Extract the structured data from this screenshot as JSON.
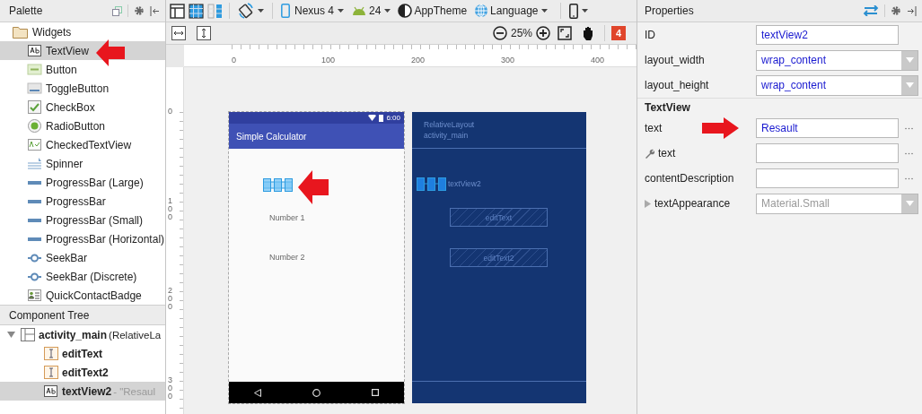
{
  "palette": {
    "title": "Palette",
    "category": {
      "label": "Widgets",
      "items": [
        {
          "label": "TextView",
          "kind": "textview",
          "selected": true
        },
        {
          "label": "Button",
          "kind": "button",
          "selected": false
        },
        {
          "label": "ToggleButton",
          "kind": "toggle",
          "selected": false
        },
        {
          "label": "CheckBox",
          "kind": "checkbox",
          "selected": false
        },
        {
          "label": "RadioButton",
          "kind": "radio",
          "selected": false
        },
        {
          "label": "CheckedTextView",
          "kind": "checkedtext",
          "selected": false
        },
        {
          "label": "Spinner",
          "kind": "spinner",
          "selected": false
        },
        {
          "label": "ProgressBar (Large)",
          "kind": "progress",
          "selected": false
        },
        {
          "label": "ProgressBar",
          "kind": "progress",
          "selected": false
        },
        {
          "label": "ProgressBar (Small)",
          "kind": "progress",
          "selected": false
        },
        {
          "label": "ProgressBar (Horizontal)",
          "kind": "progress",
          "selected": false
        },
        {
          "label": "SeekBar",
          "kind": "seekbar",
          "selected": false
        },
        {
          "label": "SeekBar (Discrete)",
          "kind": "seekbar",
          "selected": false
        },
        {
          "label": "QuickContactBadge",
          "kind": "contact",
          "selected": false
        }
      ]
    }
  },
  "component_tree": {
    "title": "Component Tree",
    "root": {
      "label": "activity_main",
      "detail": "(RelativeLa",
      "kind": "layout",
      "expanded": true,
      "selected": false,
      "children": [
        {
          "label": "editText",
          "kind": "edittext",
          "selected": false
        },
        {
          "label": "editText2",
          "kind": "edittext",
          "selected": false
        },
        {
          "label": "textView2",
          "detail": "- \"Resaul",
          "kind": "textview",
          "selected": true
        }
      ]
    }
  },
  "toolbar": {
    "device": "Nexus 4",
    "api": "24",
    "theme": "AppTheme",
    "language": "Language",
    "zoom": "25%",
    "issues": "4"
  },
  "rulers": {
    "horizontal": [
      "0",
      "100",
      "200",
      "300",
      "400"
    ],
    "vertical": [
      "0",
      "100",
      "200",
      "300"
    ]
  },
  "design": {
    "status_time": "6:00",
    "app_title": "Simple Calculator",
    "labels": [
      "Number 1",
      "Number 2"
    ]
  },
  "blueprint": {
    "layout": "RelativeLayout",
    "id": "activity_main",
    "views": [
      {
        "label": "textView2",
        "kind": "text"
      },
      {
        "label": "editText",
        "kind": "edit"
      },
      {
        "label": "editText2",
        "kind": "edit"
      }
    ]
  },
  "properties": {
    "title": "Properties",
    "rows": [
      {
        "kind": "field",
        "label": "ID",
        "value": "textView2"
      },
      {
        "kind": "dropdown",
        "label": "layout_width",
        "value": "wrap_content",
        "disabled": false
      },
      {
        "kind": "dropdown",
        "label": "layout_height",
        "value": "wrap_content",
        "disabled": false
      },
      {
        "kind": "section",
        "label": "TextView"
      },
      {
        "kind": "field_more",
        "label": "text",
        "value": "Resault"
      },
      {
        "kind": "tools_field_more",
        "label": "text"
      },
      {
        "kind": "field_more",
        "label": "contentDescription"
      },
      {
        "kind": "expandable_dropdown",
        "label": "textAppearance",
        "value": "Material.Small",
        "disabled": true,
        "expanded": false
      }
    ]
  }
}
